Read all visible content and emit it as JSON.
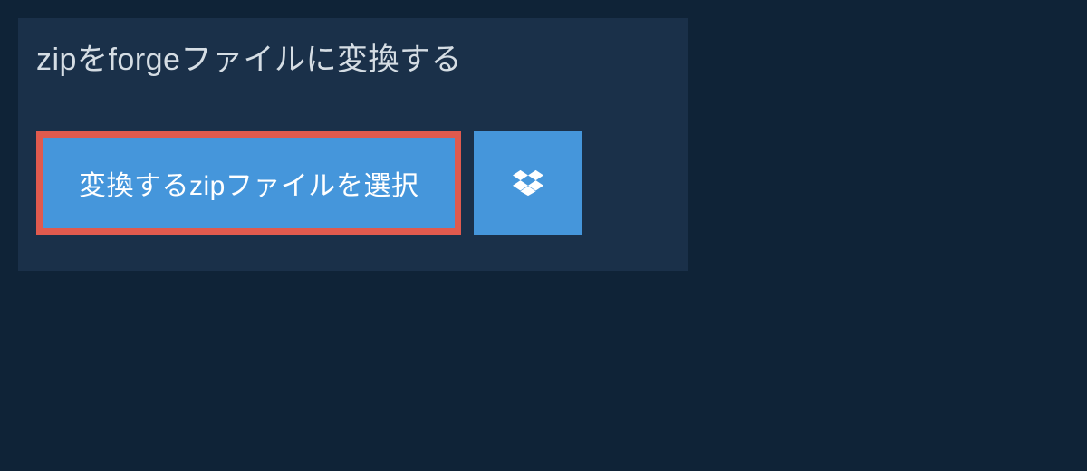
{
  "heading": "zipをforgeファイルに変換する",
  "buttons": {
    "select_file_label": "変換するzipファイルを選択"
  },
  "colors": {
    "background": "#0f2337",
    "panel": "#1a3049",
    "button_primary": "#4596db",
    "highlight_border": "#e05a4e",
    "text_light": "#d5dde4"
  }
}
